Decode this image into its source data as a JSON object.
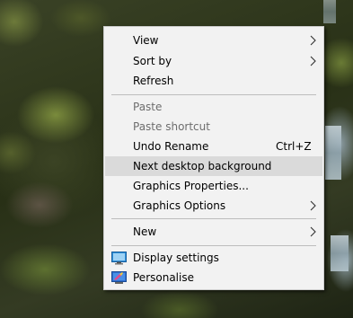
{
  "context_menu": {
    "items": [
      {
        "label": "View",
        "has_submenu": true
      },
      {
        "label": "Sort by",
        "has_submenu": true
      },
      {
        "label": "Refresh"
      },
      {
        "label": "Paste",
        "disabled": true
      },
      {
        "label": "Paste shortcut",
        "disabled": true
      },
      {
        "label": "Undo Rename",
        "shortcut": "Ctrl+Z"
      },
      {
        "label": "Next desktop background",
        "highlighted": true
      },
      {
        "label": "Graphics Properties..."
      },
      {
        "label": "Graphics Options",
        "has_submenu": true
      },
      {
        "label": "New",
        "has_submenu": true
      },
      {
        "label": "Display settings",
        "icon": "display-settings-icon"
      },
      {
        "label": "Personalise",
        "icon": "personalise-icon"
      }
    ]
  },
  "colors": {
    "menu_background": "#f2f2f2",
    "highlight": "#dadada",
    "disabled_text": "#6d6d6d",
    "separator": "#bdbdbd"
  }
}
